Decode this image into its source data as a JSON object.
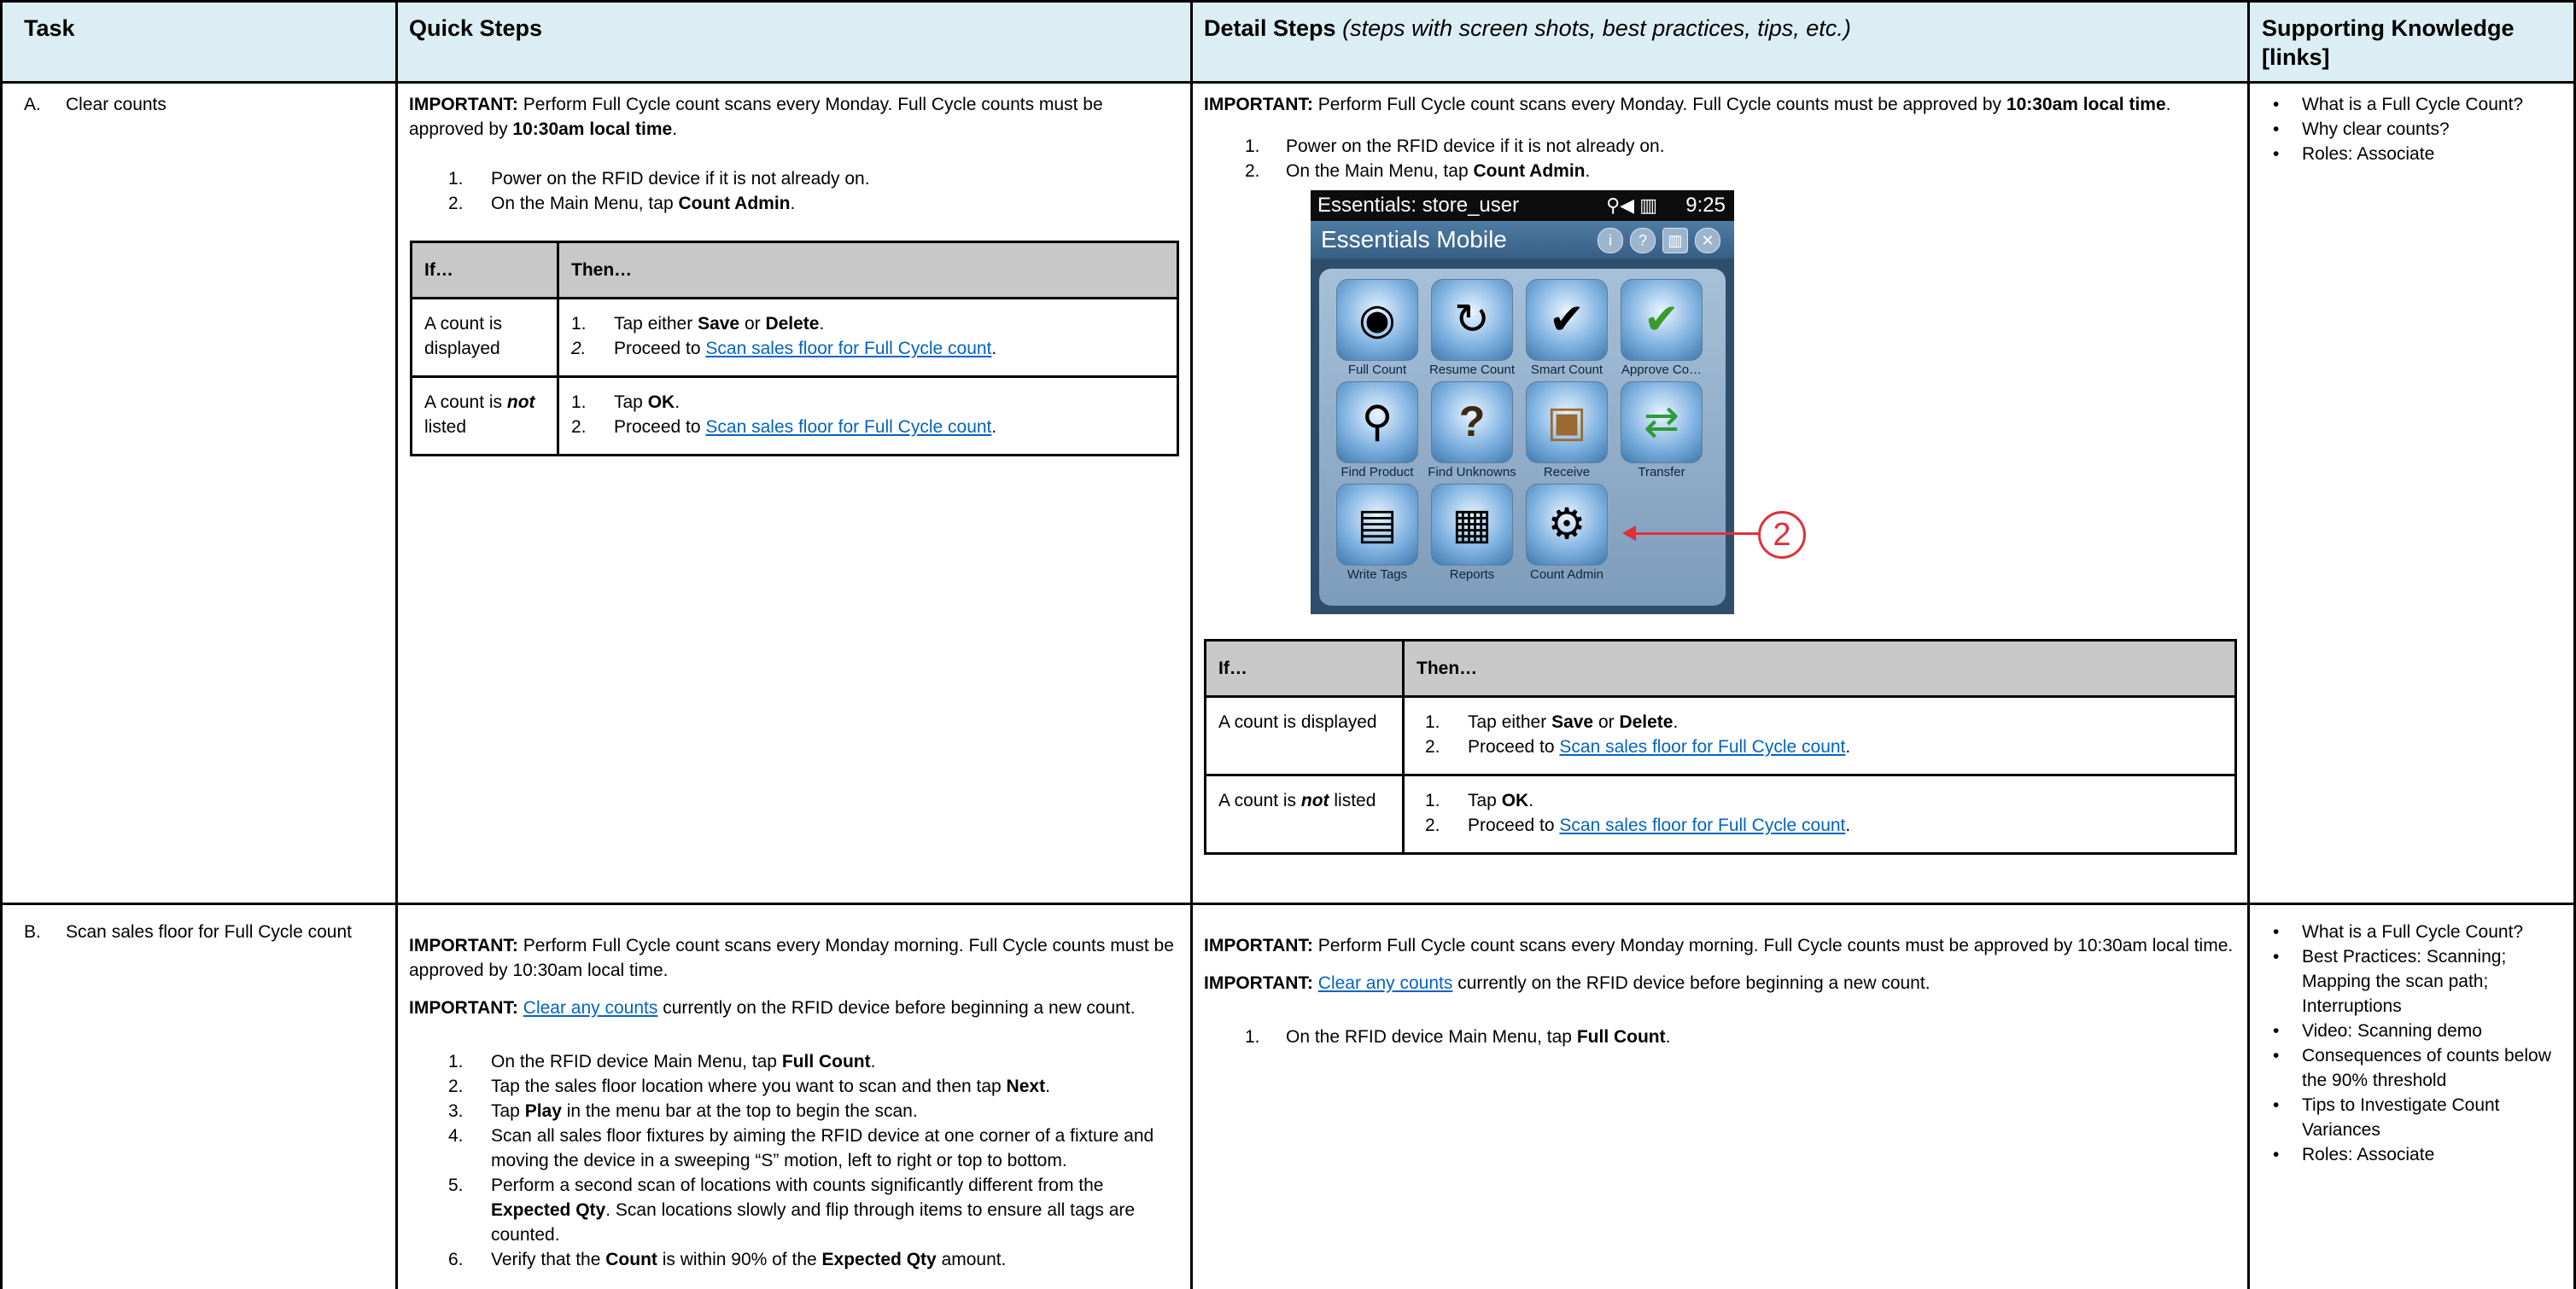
{
  "headers": {
    "task": "Task",
    "quick": "Quick Steps",
    "detail": "Detail Steps",
    "detail_sub": "(steps with screen shots, best practices, tips, etc.)",
    "support": "Supporting Knowledge [links]"
  },
  "rowA": {
    "task_letter": "A.",
    "task_name": "Clear counts",
    "quick": {
      "imp_label": "IMPORTANT:",
      "imp_text": " Perform Full Cycle count scans every Monday. Full Cycle counts must be approved by ",
      "imp_bold": "10:30am local time",
      "imp_end": ".",
      "steps": [
        {
          "n": "1.",
          "pre": "Power on the RFID device if it is not already on.",
          "b": "",
          "post": ""
        },
        {
          "n": "2.",
          "pre": "On the Main Menu, tap ",
          "b": "Count Admin",
          "post": "."
        }
      ]
    },
    "detail": {
      "imp_label": "IMPORTANT:",
      "imp_text": " Perform Full Cycle count scans every Monday. Full Cycle counts must be approved by ",
      "imp_bold": "10:30am local time",
      "imp_end": ".",
      "steps": [
        {
          "n": "1.",
          "pre": "Power on the RFID device if it is not already on.",
          "b": "",
          "post": ""
        },
        {
          "n": "2.",
          "pre": "On the Main Menu, tap ",
          "b": "Count Admin",
          "post": "."
        }
      ]
    },
    "table": {
      "h_if": "If…",
      "h_then": "Then…",
      "r1_if": "A count is displayed",
      "r1_s1_n": "1.",
      "r1_s1_pre": "Tap either ",
      "r1_s1_b1": "Save",
      "r1_s1_mid": " or ",
      "r1_s1_b2": "Delete",
      "r1_s1_end": ".",
      "r1_s2_n": "2.",
      "r1_s2_pre": "Proceed to ",
      "r1_s2_link": "Scan sales floor for Full Cycle count",
      "r1_s2_end": ".",
      "r2_if_pre": "A count is ",
      "r2_if_b": "not",
      "r2_if_post": " listed",
      "r2_s1_n": "1.",
      "r2_s1_pre": "Tap ",
      "r2_s1_b": "OK",
      "r2_s1_end": ".",
      "r2_s2_n": "2.",
      "r2_s2_pre": "Proceed to ",
      "r2_s2_link": "Scan sales floor for Full Cycle count",
      "r2_s2_end": "."
    },
    "support": [
      "What is a Full Cycle Count?",
      "Why clear counts?",
      "Roles: Associate"
    ]
  },
  "device": {
    "status_user": "Essentials: store_user",
    "status_time": "9:25",
    "status_icons": "⚲◀ ▥",
    "app_title": "Essentials Mobile",
    "title_icons": [
      "i",
      "?",
      "▥",
      "✕"
    ],
    "tiles": [
      {
        "label": "Full Count",
        "glyph": "◉"
      },
      {
        "label": "Resume Count",
        "glyph": "↻"
      },
      {
        "label": "Smart Count",
        "glyph": "✔"
      },
      {
        "label": "Approve Co…",
        "glyph": "✔"
      },
      {
        "label": "Find Product",
        "glyph": "⚲"
      },
      {
        "label": "Find Unknowns",
        "glyph": "?"
      },
      {
        "label": "Receive",
        "glyph": "▣"
      },
      {
        "label": "Transfer",
        "glyph": "⇄"
      },
      {
        "label": "Write Tags",
        "glyph": "▤"
      },
      {
        "label": "Reports",
        "glyph": "▦"
      },
      {
        "label": "Count Admin",
        "glyph": "⚙"
      }
    ],
    "callout": "2"
  },
  "rowB": {
    "task_letter": "B.",
    "task_name": "Scan sales floor for Full Cycle count",
    "quick": {
      "imp1_label": "IMPORTANT:",
      "imp1_text": " Perform Full Cycle count scans every Monday morning. Full Cycle counts must be approved by 10:30am local time.",
      "imp2_label": "IMPORTANT:",
      "imp2_link": "Clear any counts",
      "imp2_text": " currently on the RFID device before beginning a new count.",
      "steps": [
        {
          "n": "1.",
          "html_pre": "On the RFID device Main Menu, tap ",
          "b": "Full Count",
          "post": "."
        },
        {
          "n": "2.",
          "html_pre": "Tap the sales floor location where you want to scan and then tap ",
          "b": "Next",
          "post": "."
        },
        {
          "n": "3.",
          "html_pre": "Tap ",
          "b": "Play",
          "post": " in the menu bar at the top to begin the scan."
        },
        {
          "n": "4.",
          "html_pre": "Scan all sales floor fixtures by aiming the RFID device at one corner of a fixture and moving the device in a sweeping “S” motion, left to right or top to bottom.",
          "b": "",
          "post": ""
        },
        {
          "n": "5.",
          "html_pre": "Perform a second scan of locations with counts significantly different from the ",
          "b": "Expected Qty",
          "post": ". Scan locations slowly and flip through items to ensure all tags are counted."
        },
        {
          "n": "6.",
          "html_pre": "Verify that the ",
          "b": "Count",
          "post": " is within 90% of the ",
          "b2": "Expected Qty",
          "post2": " amount."
        }
      ]
    },
    "detail": {
      "imp1_label": "IMPORTANT:",
      "imp1_text": " Perform Full Cycle count scans every Monday morning. Full Cycle counts must be approved by 10:30am local time.",
      "imp2_label": "IMPORTANT:",
      "imp2_link": "Clear any counts",
      "imp2_text": " currently on the RFID device before beginning a new count.",
      "step1_n": "1.",
      "step1_pre": "On the RFID device Main Menu, tap ",
      "step1_b": "Full Count",
      "step1_end": "."
    },
    "support": [
      "What is a Full Cycle Count?",
      "Best Practices: Scanning; Mapping the scan path; Interruptions",
      "Video: Scanning demo",
      "Consequences of counts below the 90% threshold",
      "Tips to Investigate Count Variances",
      "Roles: Associate"
    ]
  }
}
